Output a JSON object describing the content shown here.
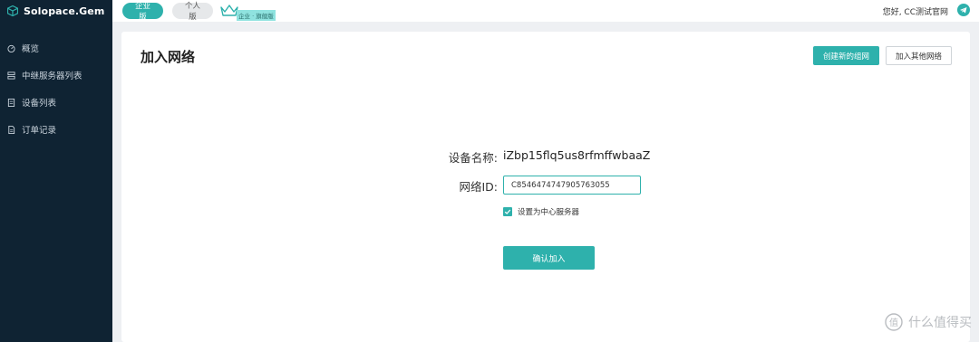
{
  "sidebar": {
    "brand": "Solopace.Gem",
    "items": [
      {
        "label": "概览",
        "icon": "dashboard-icon"
      },
      {
        "label": "中继服务器列表",
        "icon": "relay-server-icon"
      },
      {
        "label": "设备列表",
        "icon": "device-list-icon"
      },
      {
        "label": "订单记录",
        "icon": "order-record-icon"
      }
    ]
  },
  "topbar": {
    "tab_enterprise": "企业版",
    "tab_personal": "个人版",
    "badge": "企业 · 旗舰版",
    "greeting": "您好, CC测试官网"
  },
  "main": {
    "title": "加入网络",
    "create_button": "创建新的组网",
    "join_other_button": "加入其他网络",
    "device_name_label": "设备名称:",
    "device_name_value": "iZbp15flq5us8rfmffwbaaZ",
    "network_id_label": "网络ID:",
    "network_id_value": "C8546474747905763055",
    "center_server_label": "设置为中心服务器",
    "center_server_checked": true,
    "confirm_button": "确认加入"
  },
  "watermark": {
    "text": "什么值得买"
  },
  "colors": {
    "accent": "#2eb1ac",
    "sidebar_bg": "#0f2333"
  }
}
